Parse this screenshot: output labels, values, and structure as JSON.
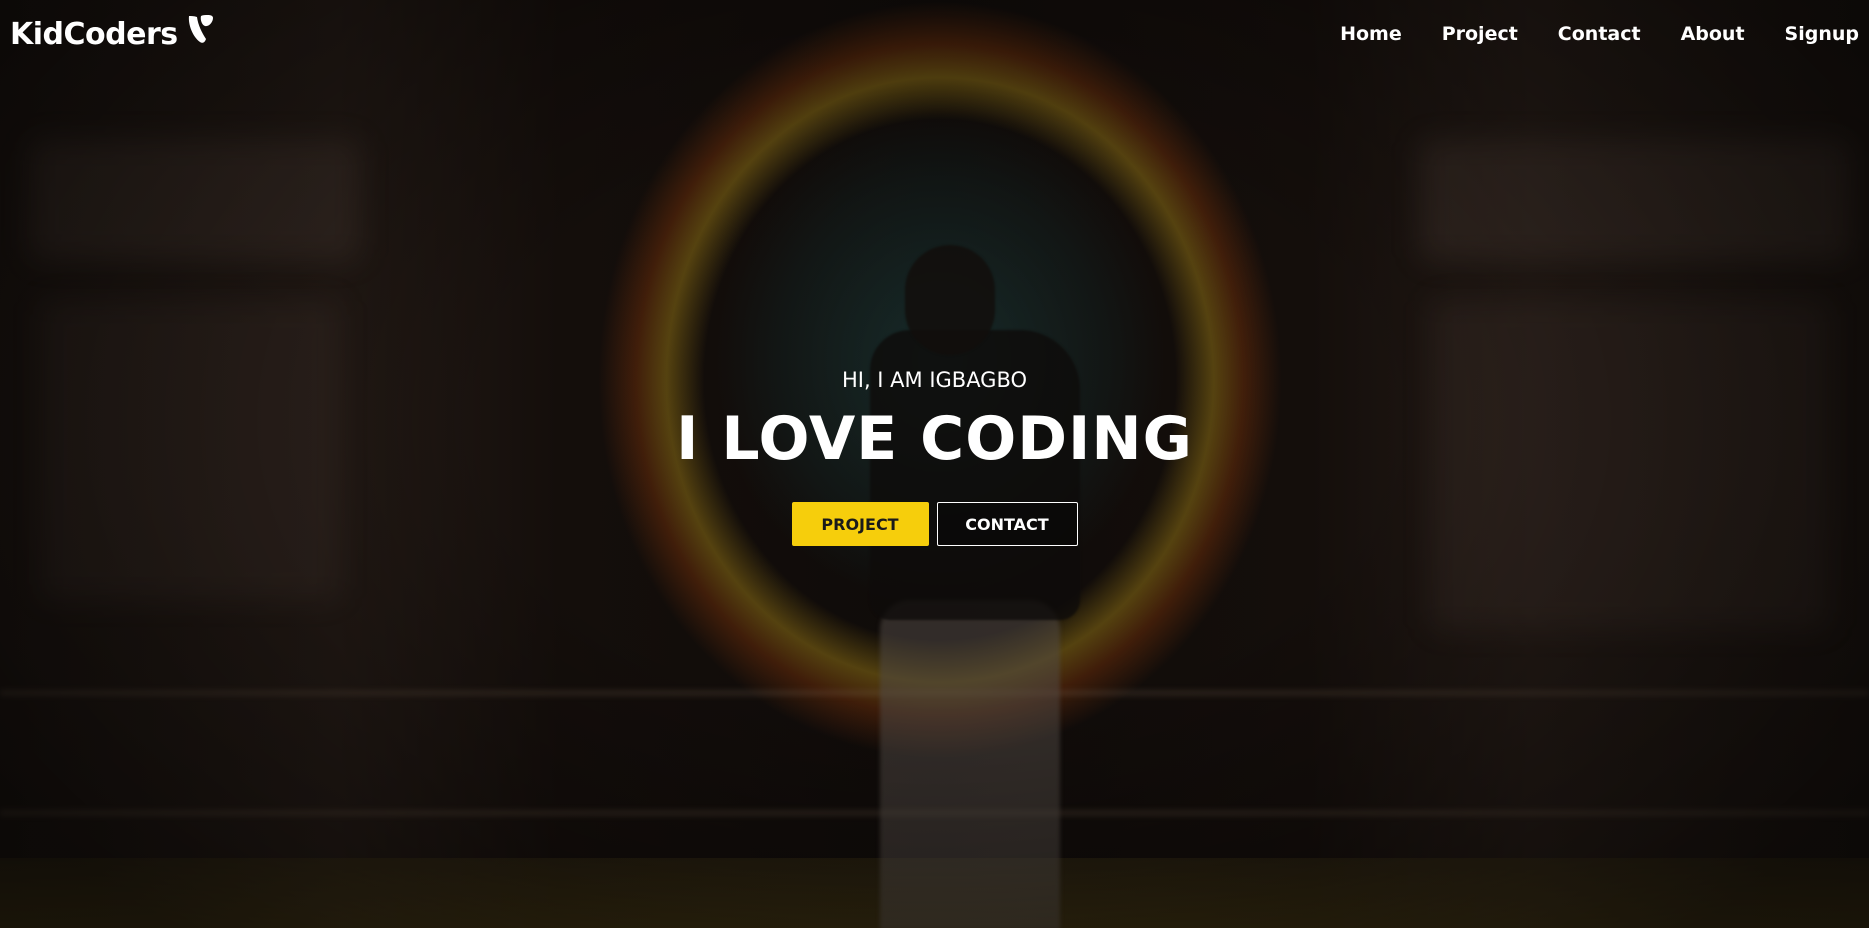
{
  "nav": {
    "logo": "KidCoders",
    "logo_icon": "typo3-logo-icon",
    "links": [
      {
        "label": "Home"
      },
      {
        "label": "Project"
      },
      {
        "label": "Contact"
      },
      {
        "label": "About"
      },
      {
        "label": "Signup"
      }
    ]
  },
  "hero": {
    "greeting": "HI, I AM IGBAGBO",
    "headline": "I LOVE CODING",
    "primary_button": "PROJECT",
    "secondary_button": "CONTACT"
  },
  "colors": {
    "accent": "#f6ce0c",
    "text": "#ffffff",
    "background": "#0a0604"
  }
}
